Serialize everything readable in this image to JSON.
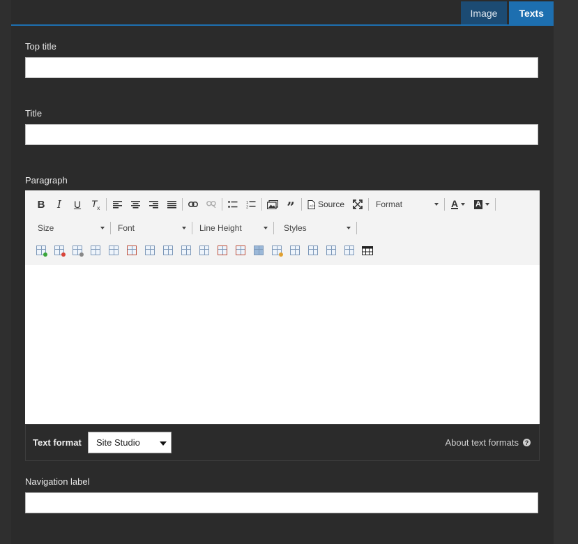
{
  "tabs": [
    {
      "label": "Image",
      "active": false
    },
    {
      "label": "Texts",
      "active": true
    }
  ],
  "fields": {
    "top_title": {
      "label": "Top title",
      "value": ""
    },
    "title": {
      "label": "Title",
      "value": ""
    },
    "paragraph": {
      "label": "Paragraph"
    },
    "navigation_label": {
      "label": "Navigation label",
      "value": ""
    }
  },
  "editor": {
    "source_label": "Source",
    "format_label": "Format",
    "size_label": "Size",
    "font_label": "Font",
    "line_height_label": "Line Height",
    "styles_label": "Styles",
    "content": ""
  },
  "text_format": {
    "label": "Text format",
    "selected": "Site Studio",
    "about_link": "About text formats",
    "help_glyph": "?"
  },
  "colors": {
    "accent": "#1d6fb0",
    "tab_inactive": "#1c4b73",
    "background": "#2b2b2b"
  }
}
